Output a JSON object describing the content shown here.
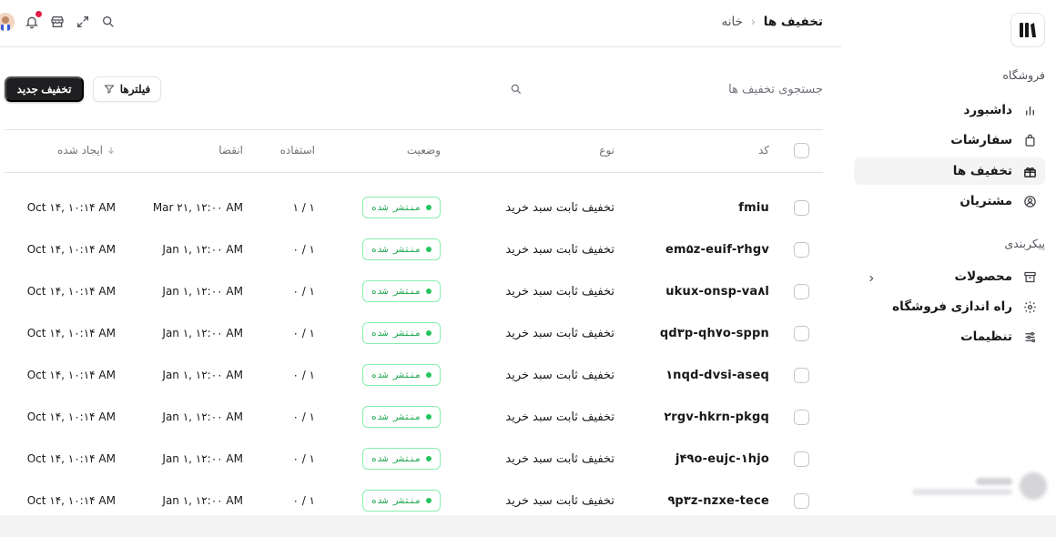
{
  "header": {
    "breadcrumb": {
      "home": "خانه",
      "separator": "‹",
      "current": "تخفیف ها"
    }
  },
  "sidebar": {
    "store_section": "فروشگاه",
    "store_items": [
      {
        "label": "داشبورد",
        "icon": "bar-chart-icon"
      },
      {
        "label": "سفارشات",
        "icon": "shopping-bag-icon"
      },
      {
        "label": "تخفیف ها",
        "icon": "ticket-icon",
        "active": true
      },
      {
        "label": "مشتریان",
        "icon": "user-circle-icon"
      }
    ],
    "config_section": "پیکربندی",
    "config_items": [
      {
        "label": "محصولات",
        "icon": "archive-icon",
        "has_submenu": true
      },
      {
        "label": "راه اندازی فروشگاه",
        "icon": "gear-icon"
      },
      {
        "label": "تنظیمات",
        "icon": "sliders-icon"
      }
    ]
  },
  "toolbar": {
    "search_placeholder": "جستجوی تخفیف ها",
    "filters_label": "فیلترها",
    "new_discount_label": "تخفیف جدید"
  },
  "table": {
    "columns": {
      "code": "کد",
      "type": "نوع",
      "status": "وضعیت",
      "usage": "استفاده",
      "expiry": "انقضا",
      "created": "ایجاد شده"
    },
    "rows": [
      {
        "code": "fmiu",
        "type": "تخفیف ثابت سبد خرید",
        "status": "منتشر شده",
        "usage": "۱ / ۱",
        "expiry": "Mar ۲۱, ۱۲:۰۰ AM",
        "created": "Oct ۱۴, ۱۰:۱۴ AM"
      },
      {
        "code": "em۵z-euif-۲hgv",
        "type": "تخفیف ثابت سبد خرید",
        "status": "منتشر شده",
        "usage": "۰ / ۱",
        "expiry": "Jan ۱, ۱۲:۰۰ AM",
        "created": "Oct ۱۴, ۱۰:۱۴ AM"
      },
      {
        "code": "ukux-onsp-va۸l",
        "type": "تخفیف ثابت سبد خرید",
        "status": "منتشر شده",
        "usage": "۰ / ۱",
        "expiry": "Jan ۱, ۱۲:۰۰ AM",
        "created": "Oct ۱۴, ۱۰:۱۴ AM"
      },
      {
        "code": "qd۳p-qh۷o-sppn",
        "type": "تخفیف ثابت سبد خرید",
        "status": "منتشر شده",
        "usage": "۰ / ۱",
        "expiry": "Jan ۱, ۱۲:۰۰ AM",
        "created": "Oct ۱۴, ۱۰:۱۴ AM"
      },
      {
        "code": "۱nqd-dvsi-aseq",
        "type": "تخفیف ثابت سبد خرید",
        "status": "منتشر شده",
        "usage": "۰ / ۱",
        "expiry": "Jan ۱, ۱۲:۰۰ AM",
        "created": "Oct ۱۴, ۱۰:۱۴ AM"
      },
      {
        "code": "۲rgv-hkrn-pkgq",
        "type": "تخفیف ثابت سبد خرید",
        "status": "منتشر شده",
        "usage": "۰ / ۱",
        "expiry": "Jan ۱, ۱۲:۰۰ AM",
        "created": "Oct ۱۴, ۱۰:۱۴ AM"
      },
      {
        "code": "j۴۹o-eujc-۱hjo",
        "type": "تخفیف ثابت سبد خرید",
        "status": "منتشر شده",
        "usage": "۰ / ۱",
        "expiry": "Jan ۱, ۱۲:۰۰ AM",
        "created": "Oct ۱۴, ۱۰:۱۴ AM"
      },
      {
        "code": "۹p۳z-nzxe-tece",
        "type": "تخفیف ثابت سبد خرید",
        "status": "منتشر شده",
        "usage": "۰ / ۱",
        "expiry": "Jan ۱, ۱۲:۰۰ AM",
        "created": "Oct ۱۴, ۱۰:۱۴ AM"
      }
    ]
  },
  "colors": {
    "accent": "#1f1f22",
    "status_green": "#22c55e",
    "notification": "#e11d48"
  }
}
